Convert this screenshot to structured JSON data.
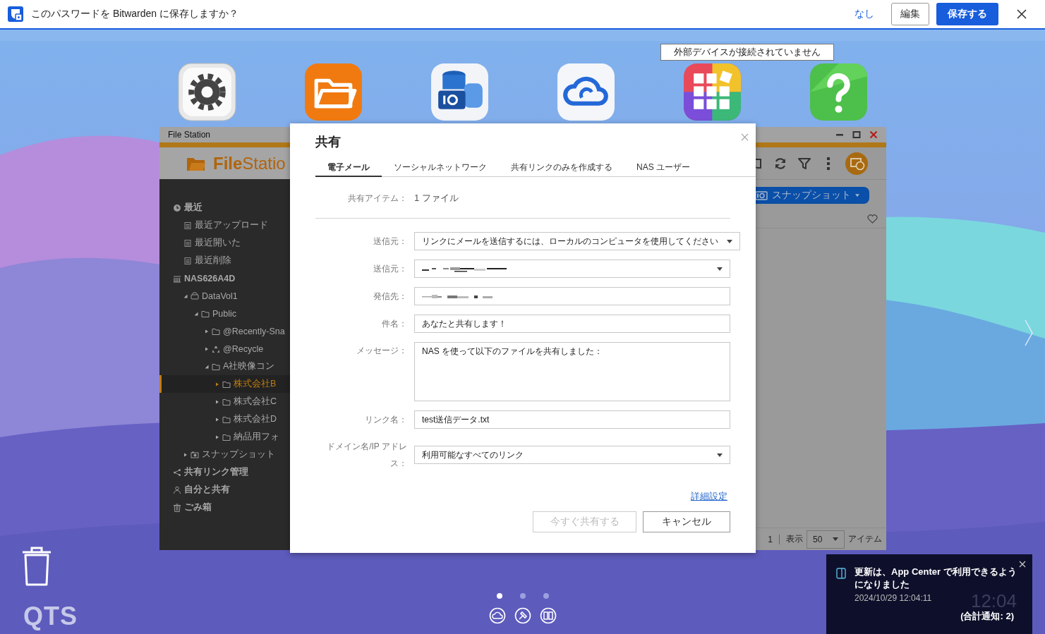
{
  "browser_prompt": {
    "message": "このパスワードを Bitwarden に保存しますか？",
    "dismiss": "なし",
    "edit": "編集",
    "save": "保存する"
  },
  "status_tooltip": "外部デバイスが接続されていません",
  "desktop_apps": [
    {
      "kind": "settings"
    },
    {
      "kind": "folder"
    },
    {
      "kind": "storage"
    },
    {
      "kind": "cloud"
    },
    {
      "kind": "grid"
    },
    {
      "kind": "help"
    }
  ],
  "file_station": {
    "title": "File Station",
    "logo": "**File**Statio",
    "sidebar": [
      {
        "label": "最近",
        "kind": "clock",
        "children": [
          {
            "label": "最近アップロード",
            "kind": "list",
            "selected": false
          },
          {
            "label": "最近開いた",
            "kind": "list",
            "selected": false
          },
          {
            "label": "最近削除",
            "kind": "list",
            "selected": false
          }
        ],
        "selected": false
      },
      {
        "label": "NAS626A4D",
        "kind": "server",
        "selected": false,
        "children": [
          {
            "label": "DataVol1",
            "kind": "drive",
            "expanded": true,
            "selected": false,
            "children": [
              {
                "label": "Public",
                "kind": "folder",
                "expanded": true,
                "selected": false,
                "children": [
                  {
                    "label": "@Recently-Sna",
                    "kind": "folder",
                    "expanded": false,
                    "selected": false
                  },
                  {
                    "label": "@Recycle",
                    "kind": "recycle",
                    "expanded": false,
                    "selected": false
                  },
                  {
                    "label": "A社映像コン",
                    "kind": "folder",
                    "expanded": true,
                    "selected": false,
                    "children": [
                      {
                        "label": "株式会社B",
                        "kind": "folder",
                        "expanded": false,
                        "selected": true
                      },
                      {
                        "label": "株式会社C",
                        "kind": "folder",
                        "expanded": false,
                        "selected": false
                      },
                      {
                        "label": "株式会社D",
                        "kind": "folder",
                        "expanded": false,
                        "selected": false
                      },
                      {
                        "label": "納品用フォ",
                        "kind": "folder",
                        "expanded": false,
                        "selected": false
                      }
                    ]
                  }
                ]
              }
            ]
          },
          {
            "label": "スナップショット",
            "kind": "camera",
            "expanded": false,
            "selected": false
          }
        ]
      },
      {
        "label": "共有リンク管理",
        "kind": "share",
        "selected": false
      },
      {
        "label": "自分と共有",
        "kind": "people",
        "selected": false
      },
      {
        "label": "ごみ箱",
        "kind": "trash",
        "selected": false
      }
    ],
    "snapshot_button": "スナップショット",
    "footer": {
      "page": "1",
      "show_label": "表示",
      "per_page": "50",
      "unit": "アイテム"
    }
  },
  "dialog": {
    "title": "共有",
    "tabs": [
      {
        "label": "電子メール",
        "selected": true
      },
      {
        "label": "ソーシャルネットワーク",
        "selected": false
      },
      {
        "label": "共有リンクのみを作成する",
        "selected": false
      },
      {
        "label": "NAS ユーザー",
        "selected": false
      }
    ],
    "item_label": "共有アイテム：",
    "item_value": "1 ファイル",
    "fields": [
      {
        "label": "送信元：",
        "kind": "select",
        "value": "リンクにメールを送信するには、ローカルのコンピュータを使用してください"
      },
      {
        "label": "送信元：",
        "kind": "select",
        "redacted": true
      },
      {
        "label": "発信先：",
        "kind": "input",
        "redacted": true
      },
      {
        "label": "件名：",
        "kind": "input",
        "value": "あなたと共有します！"
      },
      {
        "label": "メッセージ：",
        "kind": "textarea",
        "value": "NAS を使って以下のファイルを共有しました："
      },
      {
        "label": "リンク名：",
        "kind": "input",
        "value": "test送信データ.txt"
      },
      {
        "label": "ドメイン名/IP アドレス：",
        "kind": "select",
        "value": "利用可能なすべてのリンク"
      }
    ],
    "advanced_link": "詳細設定",
    "buttons": [
      {
        "label": "今すぐ共有する",
        "disabled": true
      },
      {
        "label": "キャンセル",
        "disabled": false
      }
    ]
  },
  "notification": {
    "message": "更新は、App Center で利用できるようになりました",
    "time": "2024/10/29 12:04:11",
    "summary": "(合計通知: 2)",
    "clock": "12:04"
  },
  "desktop": {
    "brand": "QTS",
    "pages": [
      {
        "selected": true
      },
      {
        "selected": false
      },
      {
        "selected": false
      }
    ],
    "dock": [
      {
        "kind": "cloud"
      },
      {
        "kind": "tools"
      },
      {
        "kind": "book"
      }
    ]
  }
}
